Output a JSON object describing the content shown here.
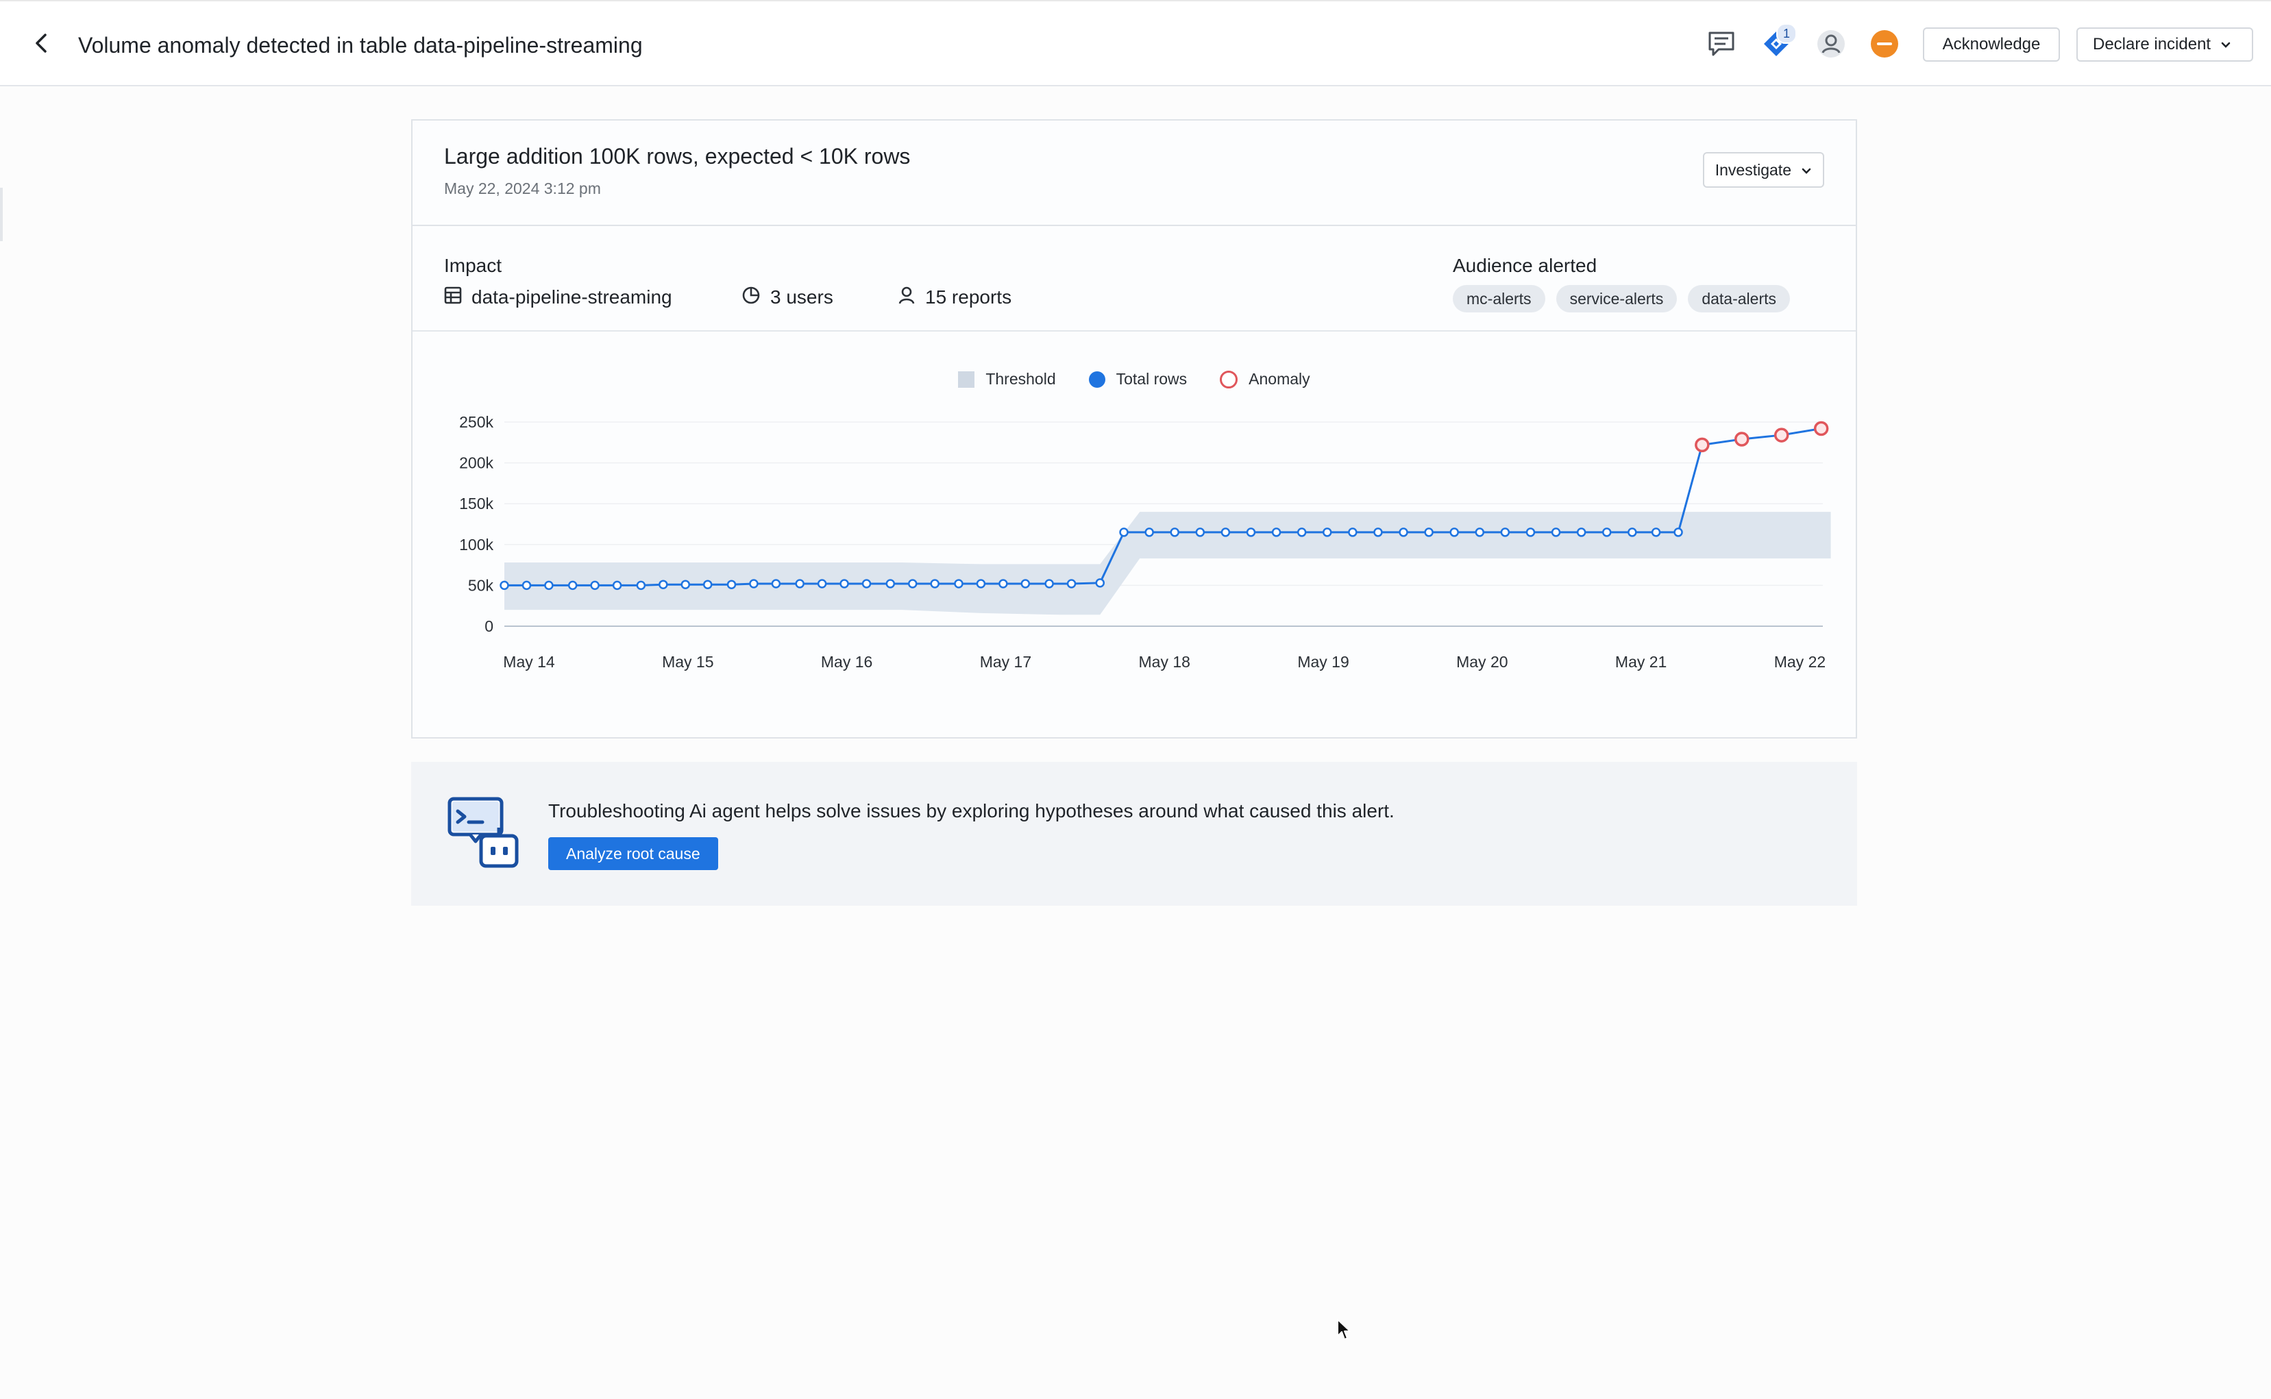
{
  "header": {
    "title": "Volume anomaly detected in table data-pipeline-streaming",
    "jira_badge_count": "1",
    "acknowledge_label": "Acknowledge",
    "declare_incident_label": "Declare incident",
    "icons": [
      "chevron-left-icon",
      "comment-icon",
      "jira-icon",
      "user-icon",
      "status-minus-icon",
      "chevron-down-icon"
    ],
    "status_color": "#f08a24"
  },
  "alert": {
    "title": "Large addition 100K rows, expected < 10K rows",
    "timestamp": "May 22, 2024 3:12 pm",
    "investigate_label": "Investigate"
  },
  "impact": {
    "label": "Impact",
    "table": "data-pipeline-streaming",
    "users": "3 users",
    "reports": "15 reports",
    "audience_label": "Audience alerted",
    "audiences": [
      "mc-alerts",
      "service-alerts",
      "data-alerts"
    ]
  },
  "chart_data": {
    "type": "line",
    "legend": [
      "Threshold",
      "Total rows",
      "Anomaly"
    ],
    "legend_placement": "top-center",
    "x_tick_labels": [
      "May 14",
      "May 15",
      "May 16",
      "May 17",
      "May 18",
      "May 19",
      "May 20",
      "May 21",
      "May 22"
    ],
    "y_tick_labels": [
      "0",
      "50k",
      "100k",
      "150k",
      "200k",
      "250k"
    ],
    "ylim": [
      0,
      250000
    ],
    "x_range": [
      0,
      8.3
    ],
    "grid": true,
    "series": [
      {
        "name": "Total rows",
        "color": "#1f74e0",
        "points": [
          [
            0,
            50000
          ],
          [
            0.14,
            50000
          ],
          [
            0.28,
            50000
          ],
          [
            0.43,
            50000
          ],
          [
            0.57,
            50000
          ],
          [
            0.71,
            50000
          ],
          [
            0.86,
            50000
          ],
          [
            1,
            51000
          ],
          [
            1.14,
            51000
          ],
          [
            1.28,
            51000
          ],
          [
            1.43,
            51000
          ],
          [
            1.57,
            52000
          ],
          [
            1.71,
            52000
          ],
          [
            1.86,
            52000
          ],
          [
            2,
            52000
          ],
          [
            2.14,
            52000
          ],
          [
            2.28,
            52000
          ],
          [
            2.43,
            52000
          ],
          [
            2.57,
            52000
          ],
          [
            2.71,
            52000
          ],
          [
            2.86,
            52000
          ],
          [
            3,
            52000
          ],
          [
            3.14,
            52000
          ],
          [
            3.28,
            52000
          ],
          [
            3.43,
            52000
          ],
          [
            3.57,
            52000
          ],
          [
            3.75,
            53000
          ],
          [
            3.9,
            115000
          ],
          [
            4.06,
            115000
          ],
          [
            4.22,
            115000
          ],
          [
            4.38,
            115000
          ],
          [
            4.54,
            115000
          ],
          [
            4.7,
            115000
          ],
          [
            4.86,
            115000
          ],
          [
            5.02,
            115000
          ],
          [
            5.18,
            115000
          ],
          [
            5.34,
            115000
          ],
          [
            5.5,
            115000
          ],
          [
            5.66,
            115000
          ],
          [
            5.82,
            115000
          ],
          [
            5.98,
            115000
          ],
          [
            6.14,
            115000
          ],
          [
            6.3,
            115000
          ],
          [
            6.46,
            115000
          ],
          [
            6.62,
            115000
          ],
          [
            6.78,
            115000
          ],
          [
            6.94,
            115000
          ],
          [
            7.1,
            115000
          ],
          [
            7.25,
            115000
          ],
          [
            7.39,
            115000
          ]
        ]
      },
      {
        "name": "Anomaly",
        "color": "#e0565b",
        "points": [
          [
            7.54,
            222000
          ],
          [
            7.79,
            229000
          ],
          [
            8.04,
            234000
          ],
          [
            8.29,
            242000
          ]
        ]
      }
    ],
    "threshold_band": {
      "name": "Threshold",
      "color": "#dde5ee",
      "points": [
        [
          0,
          78000,
          20000
        ],
        [
          1.5,
          78000,
          20000
        ],
        [
          2.5,
          78000,
          20000
        ],
        [
          3.0,
          76000,
          16000
        ],
        [
          3.5,
          76000,
          14000
        ],
        [
          3.75,
          76000,
          14000
        ],
        [
          4.0,
          140000,
          83000
        ],
        [
          5.0,
          140000,
          83000
        ],
        [
          7.0,
          140000,
          83000
        ],
        [
          8.35,
          140000,
          83000
        ]
      ]
    }
  },
  "agent": {
    "description": "Troubleshooting Ai agent helps solve issues by exploring hypotheses around what caused this alert.",
    "analyze_label": "Analyze root cause",
    "icon": "ai-agent-robot-icon",
    "accent": "#1f74e0"
  }
}
